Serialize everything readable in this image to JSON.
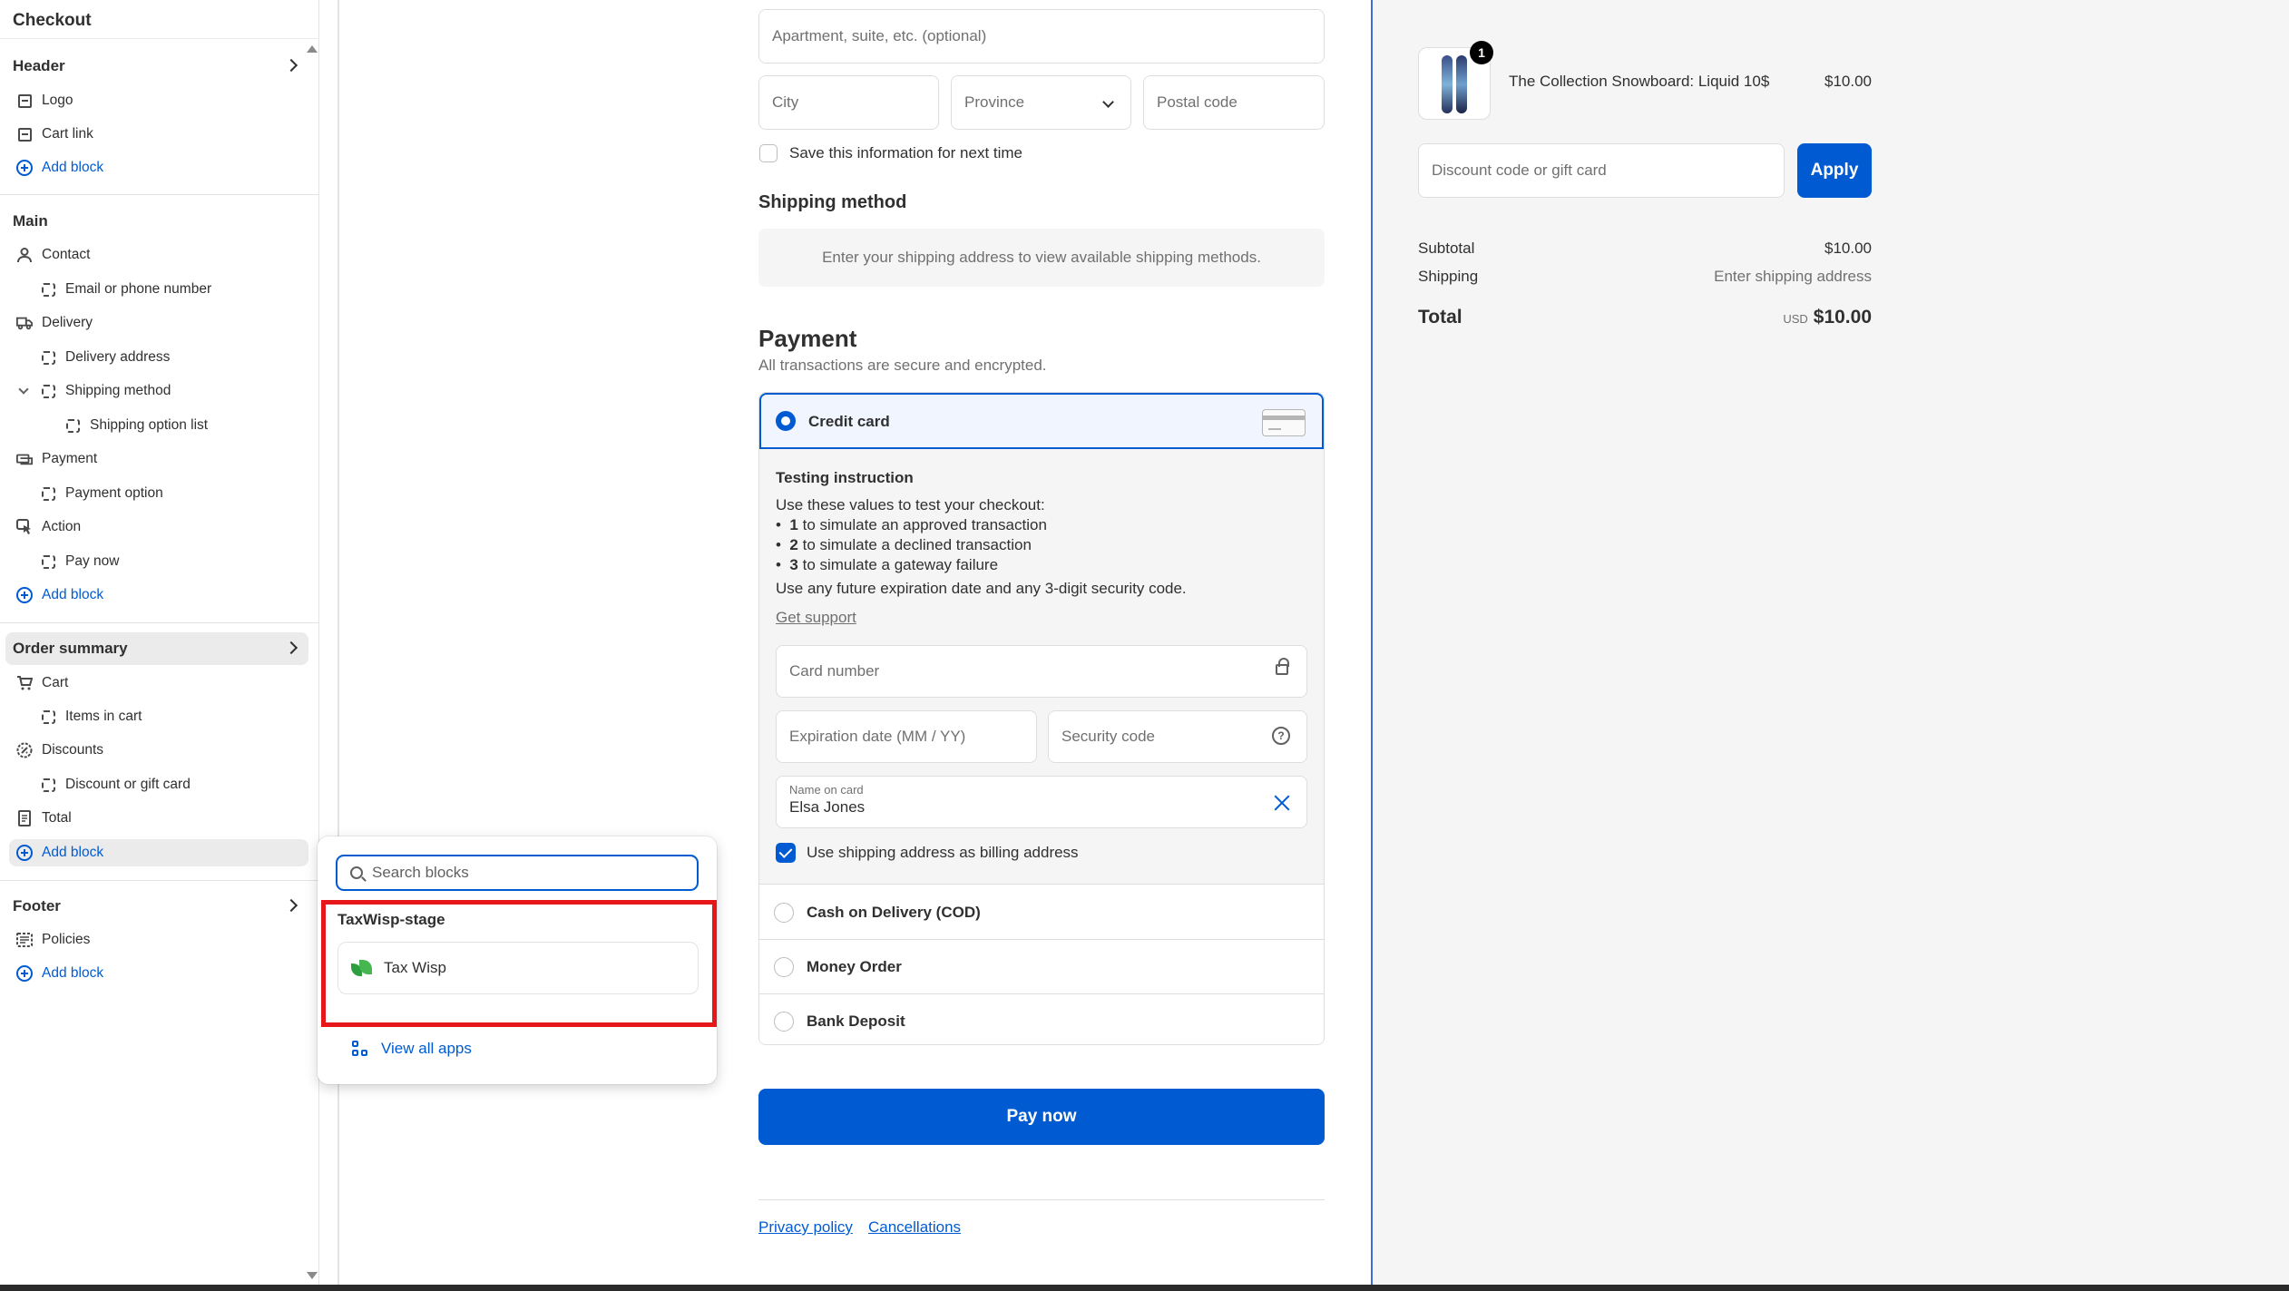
{
  "sidebar": {
    "title": "Checkout",
    "sections": [
      {
        "label": "Header",
        "items": [
          "Logo",
          "Cart link"
        ],
        "add": "Add block"
      },
      {
        "label": "Main"
      },
      {
        "label": "Order summary"
      },
      {
        "label": "Footer",
        "items": [
          "Policies"
        ],
        "add": "Add block"
      }
    ],
    "main_items": [
      "Contact",
      "Email or phone number",
      "Delivery",
      "Delivery address",
      "Shipping method",
      "Shipping option list",
      "Payment",
      "Payment option",
      "Action",
      "Pay now"
    ],
    "main_add": "Add block",
    "summary_items": [
      "Cart",
      "Items in cart",
      "Discounts",
      "Discount or gift card",
      "Total"
    ],
    "summary_add": "Add block"
  },
  "popover": {
    "search_placeholder": "Search blocks",
    "app_group": "TaxWisp-stage",
    "app_name": "Tax Wisp",
    "view_all": "View all apps"
  },
  "form": {
    "apartment_placeholder": "Apartment, suite, etc. (optional)",
    "city_placeholder": "City",
    "province_placeholder": "Province",
    "postal_placeholder": "Postal code",
    "save_info": "Save this information for next time",
    "shipping_method_title": "Shipping method",
    "shipping_method_msg": "Enter your shipping address to view available shipping methods.",
    "payment_title": "Payment",
    "payment_sub": "All transactions are secure and encrypted.",
    "credit_card": "Credit card",
    "testing_title": "Testing instruction",
    "testing_intro": "Use these values to test your checkout:",
    "testing_bullets": [
      {
        "num": "1",
        "text": " to simulate an approved transaction"
      },
      {
        "num": "2",
        "text": " to simulate a declined transaction"
      },
      {
        "num": "3",
        "text": " to simulate a gateway failure"
      }
    ],
    "testing_outro": "Use any future expiration date and any 3-digit security code.",
    "get_support": "Get support",
    "card_number_placeholder": "Card number",
    "expiry_placeholder": "Expiration date (MM / YY)",
    "security_placeholder": "Security code",
    "name_label": "Name on card",
    "name_value": "Elsa Jones",
    "billing_same": "Use shipping address as billing address",
    "cod": "Cash on Delivery (COD)",
    "money_order": "Money Order",
    "bank_deposit": "Bank Deposit",
    "pay_now": "Pay now",
    "privacy": "Privacy policy",
    "cancellations": "Cancellations"
  },
  "summary": {
    "product_name": "The Collection Snowboard: Liquid 10$",
    "product_price": "$10.00",
    "quantity": "1",
    "discount_placeholder": "Discount code or gift card",
    "apply": "Apply",
    "subtotal_label": "Subtotal",
    "subtotal_value": "$10.00",
    "shipping_label": "Shipping",
    "shipping_value": "Enter shipping address",
    "total_label": "Total",
    "currency": "USD",
    "total_value": "$10.00"
  },
  "colors": {
    "accent": "#005bd3",
    "highlight_box": "#e5171b",
    "app_icon": "#2e9f3e"
  }
}
